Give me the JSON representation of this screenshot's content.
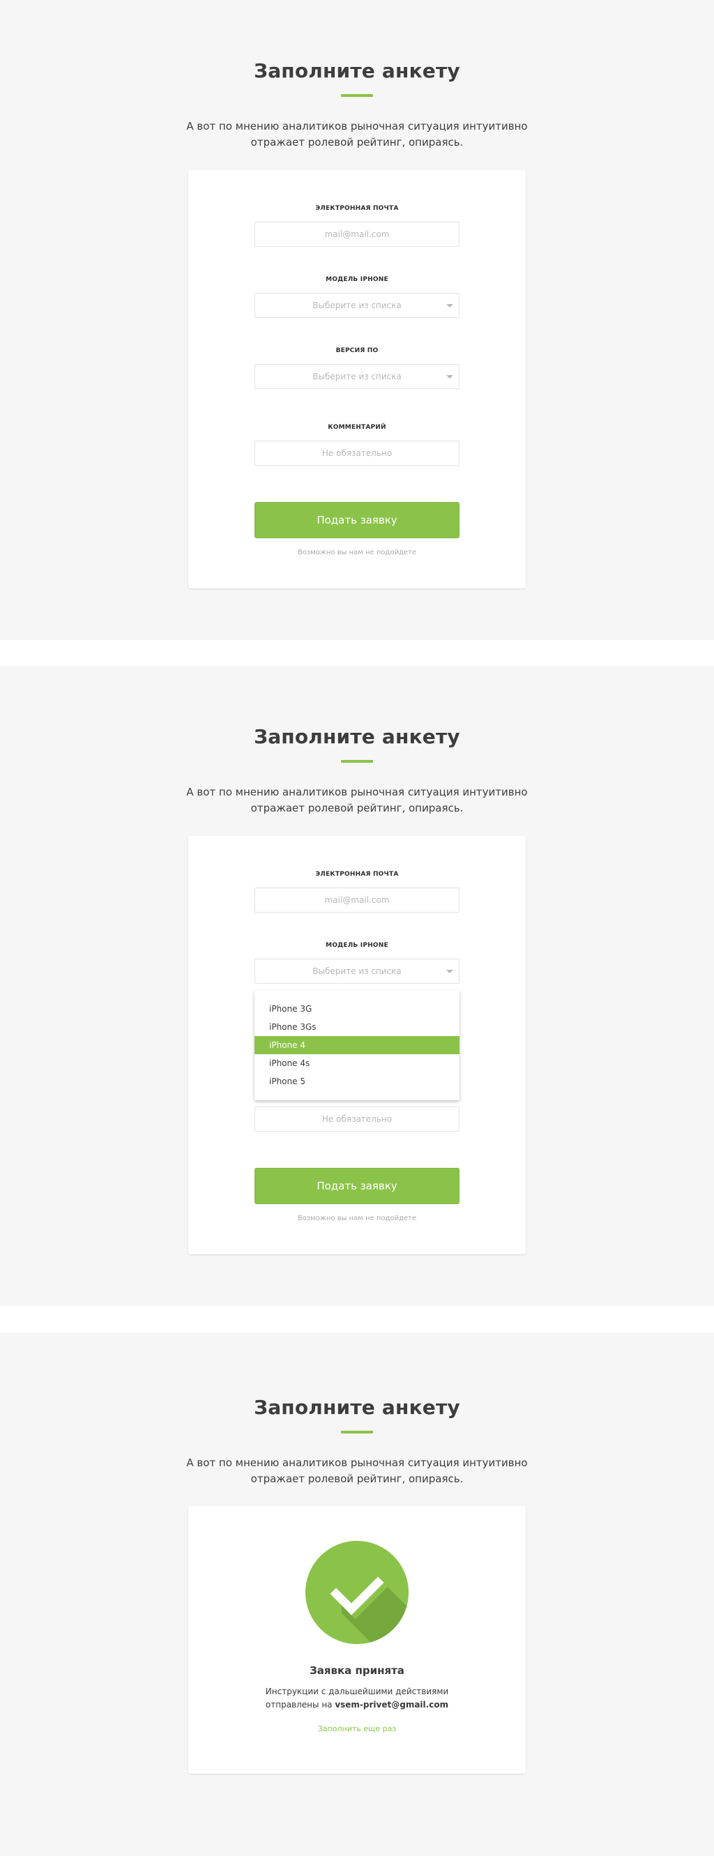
{
  "form_section": {
    "title": "Заполните анкету",
    "lead_line1": "А вот по мнению аналитиков рыночная ситуация интуитивно",
    "lead_line2": "отражает ролевой рейтинг, опираясь.",
    "email_label": "ЭЛЕКТРОННАЯ ПОЧТА",
    "email_placeholder": "mail@mail.com",
    "model_label": "МОДЕЛЬ IPHONE",
    "model_placeholder": "Выберите из списка",
    "version_label": "ВЕРСИЯ ПО",
    "version_placeholder": "Выберите из списка",
    "comment_label": "КОММЕНТАРИЙ",
    "comment_placeholder": "Не обязательно",
    "submit_label": "Подать заявку",
    "note": "Возможно вы нам не подойдете"
  },
  "dropdown": {
    "options": [
      "iPhone 3G",
      "iPhone 3Gs",
      "iPhone 4",
      "iPhone 4s",
      "iPhone 5"
    ],
    "highlighted": "iPhone 4"
  },
  "success": {
    "title": "Заявка принята",
    "text_line1": "Инструкции с дальшейшими действиями",
    "text_prefix": "отправлены на ",
    "email": "vsem-privet@gmail.com",
    "again_link": "Заполнить еще раз"
  },
  "colors": {
    "accent": "#8bc34a",
    "accent_dark": "#75a83c",
    "section_bg": "#f6f6f6"
  },
  "icons": {
    "select_caret": "chevron-down-icon",
    "success": "check-circle-icon"
  }
}
